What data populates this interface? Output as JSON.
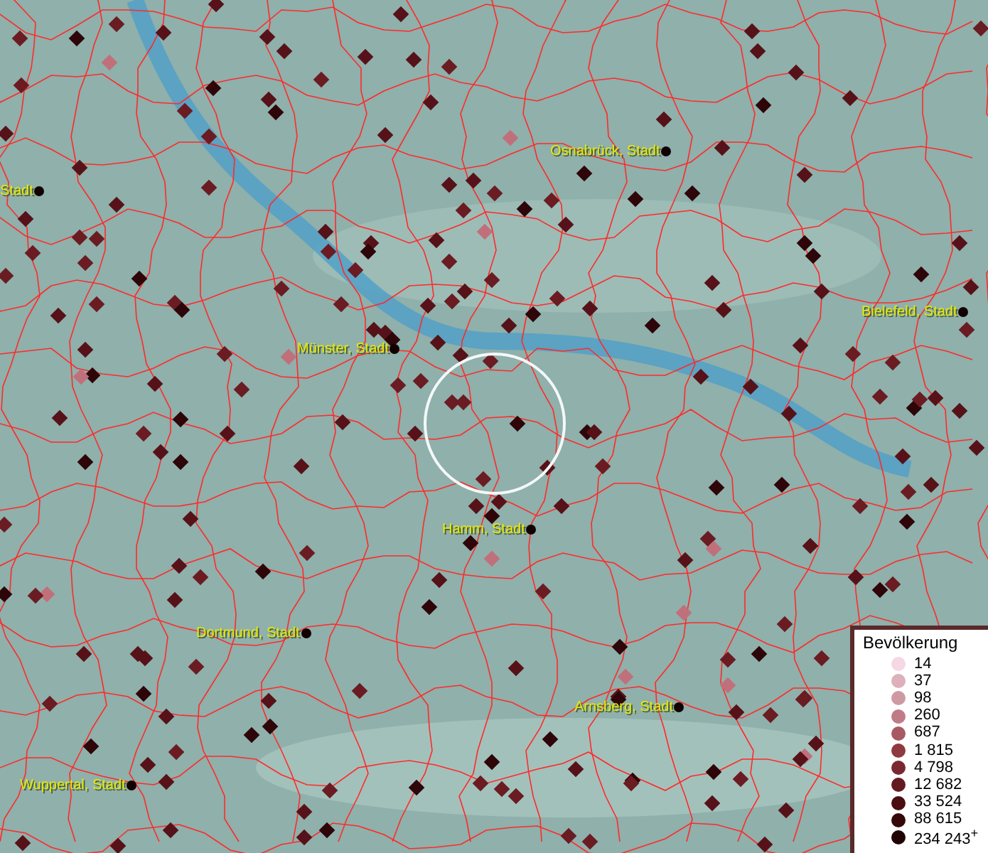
{
  "map": {
    "cities": [
      {
        "name": "Stadt"
      },
      {
        "name": "Osnabrück, Stadt"
      },
      {
        "name": "Bielefeld, Stadt"
      },
      {
        "name": "Münster, Stadt"
      },
      {
        "name": "Hamm, Stadt"
      },
      {
        "name": "Dortmund, Stadt"
      },
      {
        "name": "Arnsberg, Stadt"
      },
      {
        "name": "Wuppertal, Stadt"
      }
    ]
  },
  "legend": {
    "title": "Bevölkerung",
    "items": [
      {
        "label": "14",
        "color": "#f5d8e4"
      },
      {
        "label": "37",
        "color": "#ddb0bc"
      },
      {
        "label": "98",
        "color": "#cf99a3"
      },
      {
        "label": "260",
        "color": "#c07c86"
      },
      {
        "label": "687",
        "color": "#a85a62"
      },
      {
        "label": "1 815",
        "color": "#8e3a40"
      },
      {
        "label": "4 798",
        "color": "#7a2830"
      },
      {
        "label": "12 682",
        "color": "#641a20"
      },
      {
        "label": "33 524",
        "color": "#4a0e12"
      },
      {
        "label": "88 615",
        "color": "#360808"
      },
      {
        "label": "234 243$^{+}$",
        "color": "#200404"
      }
    ]
  }
}
